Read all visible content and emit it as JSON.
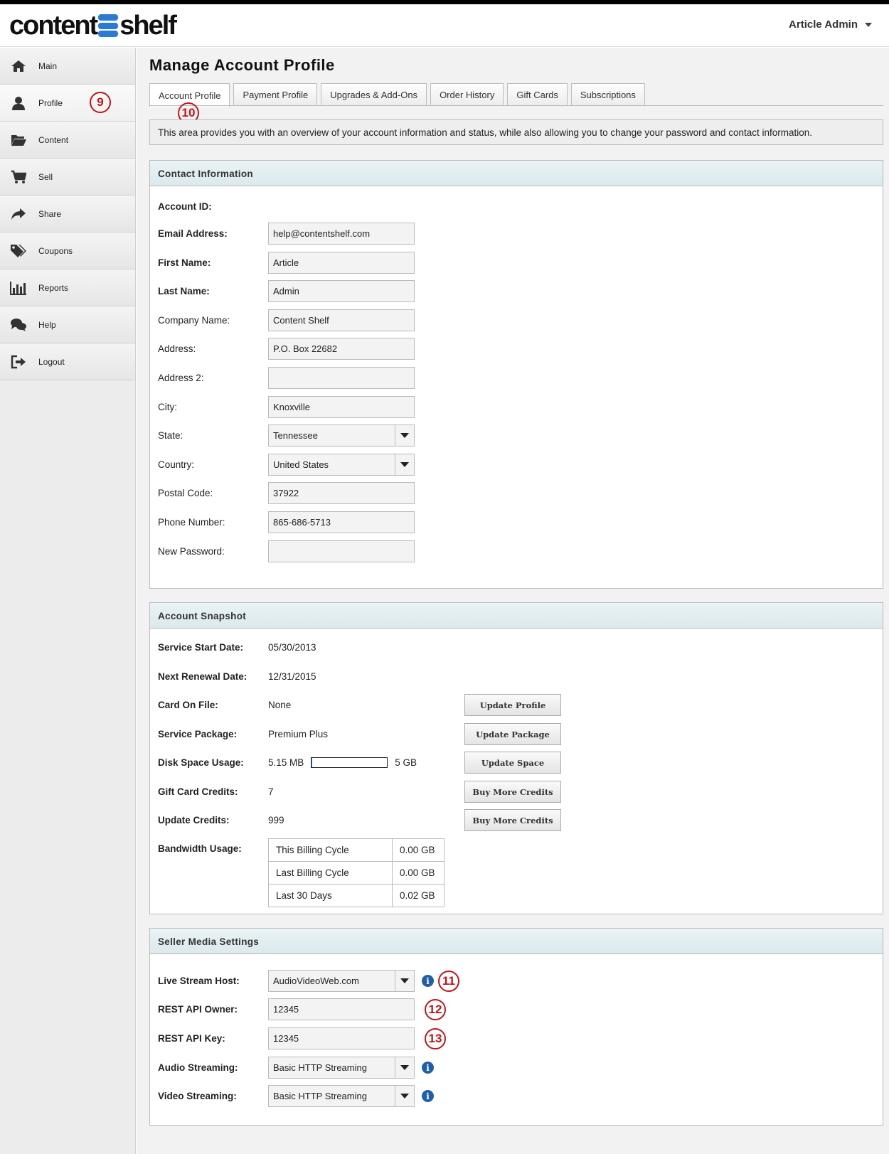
{
  "app": {
    "logo_left": "content",
    "logo_right": "shelf",
    "user_name": "Article Admin"
  },
  "sidebar": {
    "items": [
      {
        "label": "Main",
        "icon": "home-icon"
      },
      {
        "label": "Profile",
        "icon": "user-icon",
        "annotation": "9"
      },
      {
        "label": "Content",
        "icon": "folder-icon"
      },
      {
        "label": "Sell",
        "icon": "cart-icon"
      },
      {
        "label": "Share",
        "icon": "share-arrow-icon"
      },
      {
        "label": "Coupons",
        "icon": "tags-icon"
      },
      {
        "label": "Reports",
        "icon": "bar-chart-icon"
      },
      {
        "label": "Help",
        "icon": "chat-bubbles-icon"
      },
      {
        "label": "Logout",
        "icon": "logout-icon"
      }
    ]
  },
  "page": {
    "title": "Manage Account Profile",
    "tabs": [
      "Account Profile",
      "Payment Profile",
      "Upgrades & Add-Ons",
      "Order History",
      "Gift Cards",
      "Subscriptions"
    ],
    "tab_annotation": "10",
    "intro": "This area provides you with an overview of your account information and status, while also allowing you to change your password and contact information."
  },
  "contact": {
    "heading": "Contact Information",
    "account_id_label": "Account ID:",
    "email_label": "Email Address:",
    "email": "help@contentshelf.com",
    "first_name_label": "First Name:",
    "first_name": "Article",
    "last_name_label": "Last Name:",
    "last_name": "Admin",
    "company_label": "Company Name:",
    "company": "Content Shelf",
    "address_label": "Address:",
    "address": "P.O. Box 22682",
    "address2_label": "Address 2:",
    "address2": "",
    "city_label": "City:",
    "city": "Knoxville",
    "state_label": "State:",
    "state": "Tennessee",
    "country_label": "Country:",
    "country": "United States",
    "postal_label": "Postal Code:",
    "postal": "37922",
    "phone_label": "Phone Number:",
    "phone": "865-686-5713",
    "password_label": "New Password:",
    "password": ""
  },
  "snapshot": {
    "heading": "Account Snapshot",
    "start_label": "Service Start Date:",
    "start": "05/30/2013",
    "renewal_label": "Next Renewal Date:",
    "renewal": "12/31/2015",
    "card_label": "Card On File:",
    "card": "None",
    "package_label": "Service Package:",
    "package": "Premium Plus",
    "disk_label": "Disk Space Usage:",
    "disk_used": "5.15 MB",
    "disk_total": "5 GB",
    "disk_fraction": 0.001,
    "gift_label": "Gift Card Credits:",
    "gift": "7",
    "update_label": "Update Credits:",
    "update": "999",
    "bandwidth_label": "Bandwidth Usage:",
    "bandwidth": [
      {
        "period": "This Billing Cycle",
        "value": "0.00 GB"
      },
      {
        "period": "Last Billing Cycle",
        "value": "0.00 GB"
      },
      {
        "period": "Last 30 Days",
        "value": "0.02 GB"
      }
    ],
    "buttons": {
      "update_profile": "Update Profile",
      "update_package": "Update Package",
      "update_space": "Update Space",
      "buy_gift": "Buy More Credits",
      "buy_update": "Buy More Credits"
    }
  },
  "media": {
    "heading": "Seller Media Settings",
    "host_label": "Live Stream Host:",
    "host": "AudioVideoWeb.com",
    "host_annotation": "11",
    "owner_label": "REST API Owner:",
    "owner": "12345",
    "owner_annotation": "12",
    "key_label": "REST API Key:",
    "key": "12345",
    "key_annotation": "13",
    "audio_label": "Audio Streaming:",
    "audio": "Basic HTTP Streaming",
    "video_label": "Video Streaming:",
    "video": "Basic HTTP Streaming"
  },
  "colors": {
    "accent": "#2b7bd6",
    "annotation": "#c0151b",
    "info": "#1f5fa8"
  }
}
